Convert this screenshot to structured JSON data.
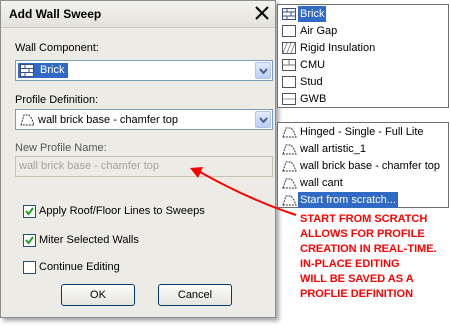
{
  "dialog": {
    "title": "Add Wall Sweep",
    "wall_component_label": "Wall Component:",
    "wall_component_value": "Brick",
    "profile_definition_label": "Profile Definition:",
    "profile_definition_value": "wall brick base - chamfer top",
    "new_profile_name_label": "New Profile Name:",
    "new_profile_name_value": "wall brick base - chamfer top",
    "checkboxes": [
      {
        "label": "Apply Roof/Floor Lines to Sweeps",
        "checked": true
      },
      {
        "label": "Miter Selected Walls",
        "checked": true
      },
      {
        "label": "Continue Editing",
        "checked": false
      }
    ],
    "ok_label": "OK",
    "cancel_label": "Cancel"
  },
  "component_list": [
    "Brick",
    "Air Gap",
    "Rigid Insulation",
    "CMU",
    "Stud",
    "GWB"
  ],
  "profile_list": [
    "Hinged - Single - Full Lite",
    "wall artistic_1",
    "wall brick base - chamfer top",
    "wall cant",
    "Start from scratch..."
  ],
  "annotation": [
    "START FROM SCRATCH",
    "ALLOWS FOR PROFILE",
    "CREATION IN REAL-TIME.",
    "IN-PLACE EDITING",
    "WILL BE SAVED AS A",
    "PROFLIE DEFINITION"
  ],
  "colors": {
    "highlight": "#316ac5",
    "annotation": "#ff0000",
    "dialog_bg": "#ecebe6"
  },
  "icons": {
    "component": "brick-icon",
    "profile": "profile-shape-icon",
    "close": "close-icon"
  }
}
